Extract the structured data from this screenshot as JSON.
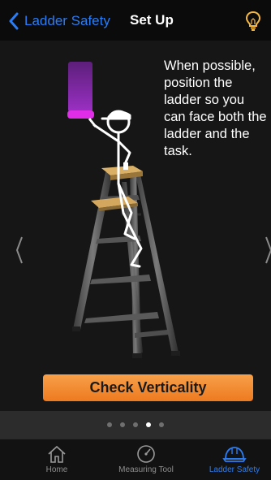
{
  "nav": {
    "back_label": "Ladder Safety",
    "title": "Set Up",
    "tip_icon": "lightbulb-icon"
  },
  "content": {
    "instruction": "When possible, position the ladder so you can face both the ladder and the task."
  },
  "check_button": {
    "label": "Check Verticality"
  },
  "pager": {
    "total": 5,
    "active_index": 3
  },
  "tabs": [
    {
      "label": "Home",
      "icon": "home-icon",
      "active": false
    },
    {
      "label": "Measuring Tool",
      "icon": "gauge-icon",
      "active": false
    },
    {
      "label": "Ladder Safety",
      "icon": "hardhat-icon",
      "active": true
    }
  ],
  "colors": {
    "accent": "#2b7df5",
    "button": "#f0842a",
    "tip_icon": "#f5b942",
    "paint": "#8e2bb5"
  }
}
